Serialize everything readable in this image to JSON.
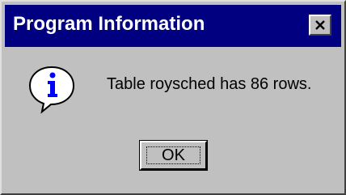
{
  "window": {
    "title": "Program Information",
    "title_bar_color": "#000080",
    "close_icon": "close-icon"
  },
  "dialog": {
    "icon": "info-icon",
    "message": "Table roysched has 86 rows.",
    "ok_label": "OK"
  }
}
